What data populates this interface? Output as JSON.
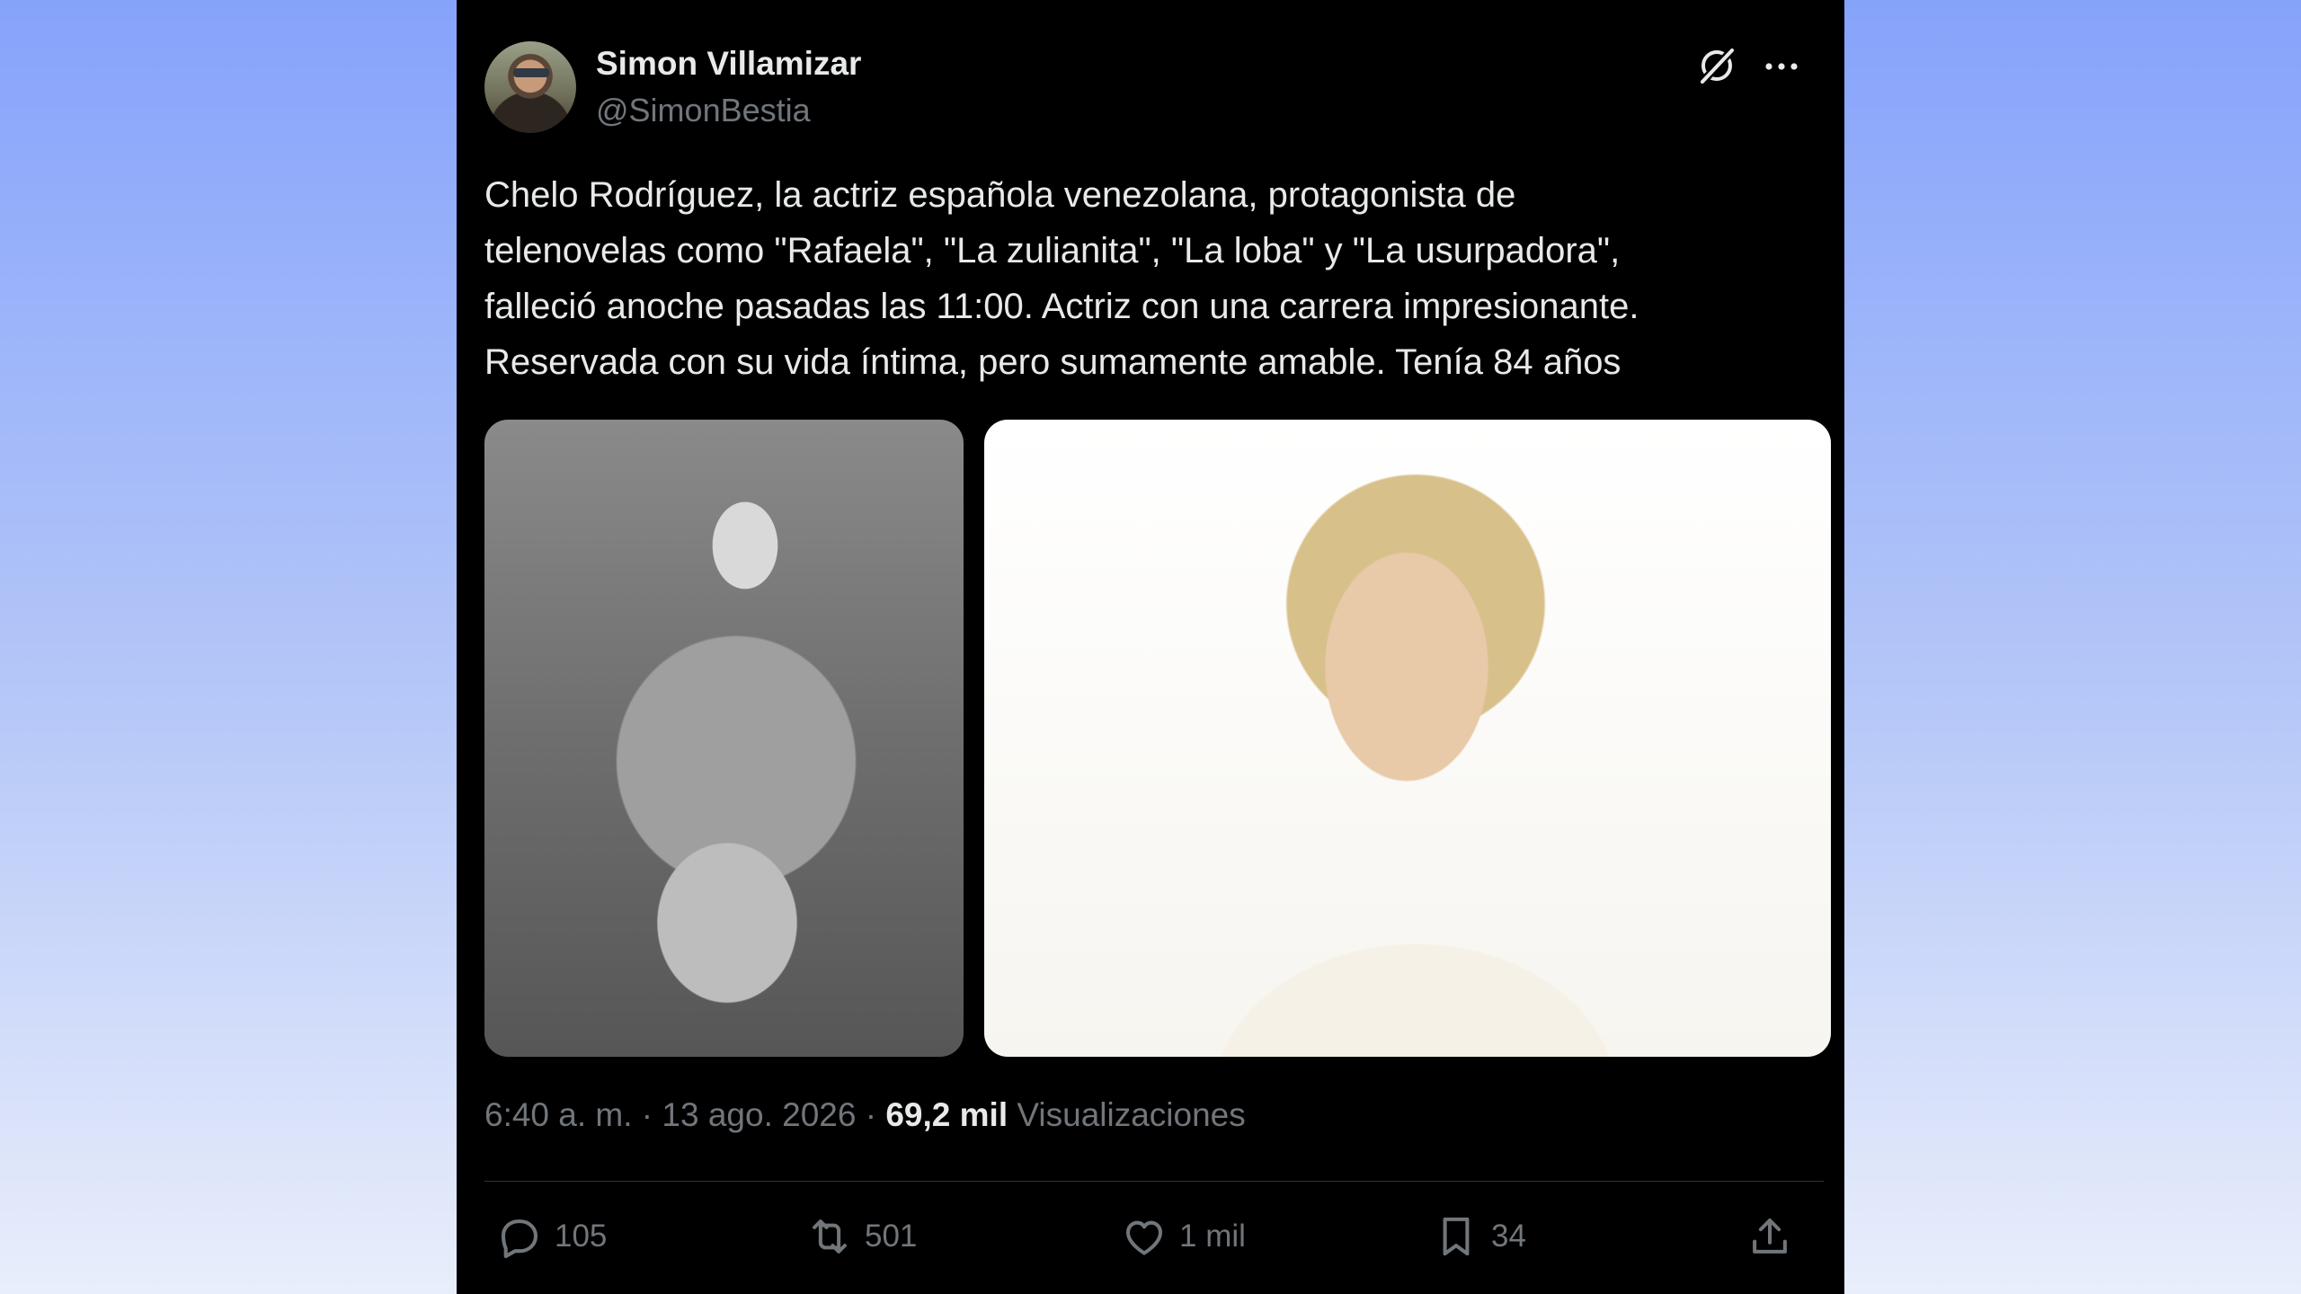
{
  "author": {
    "display_name": "Simon Villamizar",
    "handle": "@SimonBestia"
  },
  "tweet": {
    "text_lines": [
      "Chelo Rodríguez, la actriz española venezolana, protagonista de",
      "telenovelas como \"Rafaela\", \"La zulianita\", \"La loba\" y \"La usurpadora\",",
      "falleció anoche pasadas las 11:00. Actriz con una carrera impresionante.",
      "Reservada con su vida íntima, pero sumamente amable. Tenía 84 años"
    ]
  },
  "meta": {
    "time": "6:40 a. m.",
    "separator": " · ",
    "date": "13 ago. 2026",
    "views_count": "69,2 mil",
    "views_label": "Visualizaciones"
  },
  "actions": {
    "replies": "105",
    "retweets": "501",
    "likes": "1 mil",
    "bookmarks": "34"
  },
  "icons": {
    "header": [
      "grok-icon",
      "more-icon"
    ],
    "actions": [
      "reply-icon",
      "retweet-icon",
      "like-icon",
      "bookmark-icon",
      "share-icon"
    ]
  },
  "colors": {
    "card_bg": "#000000",
    "primary_text": "#e7e9ea",
    "secondary_text": "#71767b",
    "divider": "#2f3336"
  }
}
